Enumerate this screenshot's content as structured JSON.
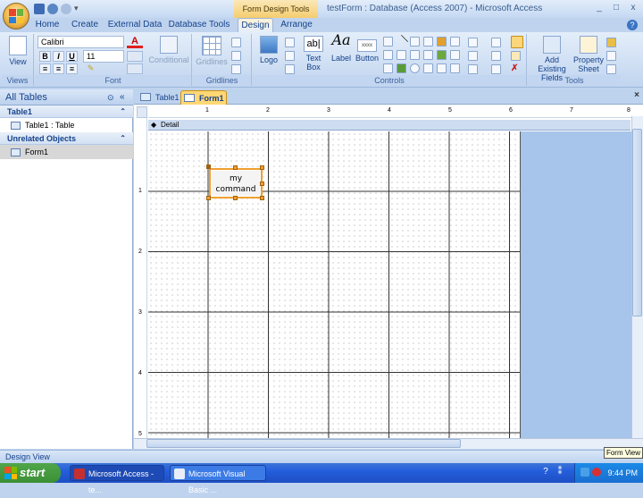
{
  "window": {
    "title": "testForm : Database (Access 2007) - Microsoft Access",
    "contextual_tab_group": "Form Design Tools",
    "controls": [
      "_",
      "□",
      "x"
    ]
  },
  "ribbon_tabs": [
    {
      "label": "Home"
    },
    {
      "label": "Create"
    },
    {
      "label": "External Data"
    },
    {
      "label": "Database Tools"
    },
    {
      "label": "Design"
    },
    {
      "label": "Arrange"
    }
  ],
  "ribbon": {
    "views": {
      "group_label": "Views",
      "view_label": "View"
    },
    "font": {
      "group_label": "Font",
      "font_name": "Calibri",
      "font_size": "11",
      "bold": "B",
      "italic": "I",
      "underline": "U",
      "conditional": "Conditional"
    },
    "gridlines": {
      "group_label": "Gridlines",
      "gridlines_label": "Gridlines"
    },
    "controls": {
      "group_label": "Controls",
      "logo": "Logo",
      "text_box": "Text Box",
      "label": "Label",
      "button": "Button",
      "label_glyph": "Aa",
      "textbox_glyph": "ab|",
      "button_glyph": "xxxx"
    },
    "tools": {
      "group_label": "Tools",
      "add_fields": "Add Existing Fields",
      "property_sheet": "Property Sheet"
    }
  },
  "nav_pane": {
    "header": "All Tables",
    "groups": [
      {
        "title": "Table1",
        "items": [
          "Table1 : Table"
        ]
      },
      {
        "title": "Unrelated Objects",
        "items": [
          "Form1"
        ]
      }
    ]
  },
  "doc_tabs": [
    {
      "label": "Table1"
    },
    {
      "label": "Form1"
    }
  ],
  "form_design": {
    "section_label": "Detail",
    "button_caption_line1": "my",
    "button_caption_line2": "command",
    "ruler_top_numbers": [
      "1",
      "2",
      "3",
      "4",
      "5",
      "6",
      "7",
      "8"
    ],
    "ruler_left_numbers": [
      "1",
      "2",
      "3",
      "4",
      "5"
    ]
  },
  "status": {
    "left_text": "Design View",
    "tooltip": "Form View"
  },
  "taskbar": {
    "start_label": "start",
    "items": [
      {
        "label": "Microsoft Access - te..."
      },
      {
        "label": "Microsoft Visual Basic ..."
      }
    ],
    "clock": "9:44 PM"
  },
  "colors": {
    "ribbon_bg": "#cbdcf2",
    "selection_orange": "#f0a030",
    "taskbar_blue": "#245edb",
    "form_bg_blue": "#a7c4ea"
  }
}
